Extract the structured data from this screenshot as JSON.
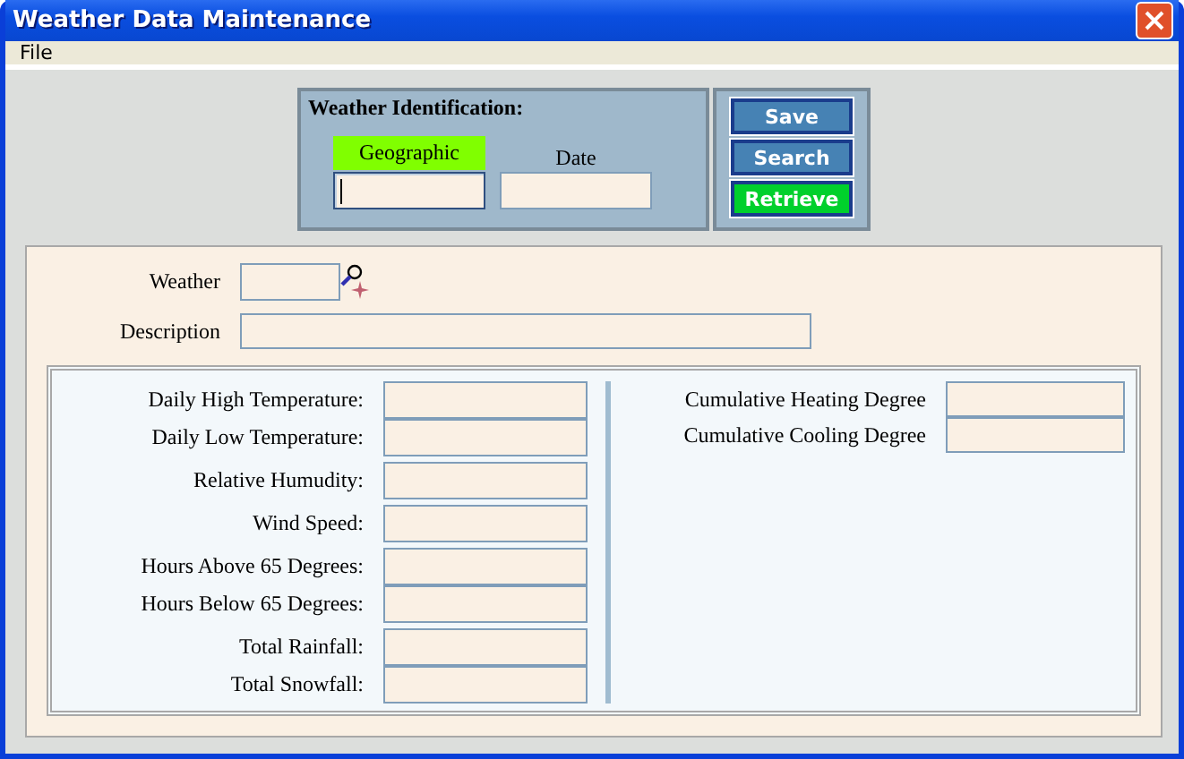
{
  "window": {
    "title": "Weather Data Maintenance"
  },
  "menu": [
    "File"
  ],
  "identification": {
    "title": "Weather Identification:",
    "fields": [
      {
        "label": "Geographic",
        "highlighted": true,
        "focused": true
      },
      {
        "label": "Date",
        "highlighted": false,
        "focused": false
      }
    ]
  },
  "buttons": [
    {
      "label": "Save",
      "color": "#4682b4"
    },
    {
      "label": "Search",
      "color": "#4682b4"
    },
    {
      "label": "Retrieve",
      "color": "#00d02c"
    }
  ],
  "weather": {
    "label": "Weather"
  },
  "description": {
    "label": "Description"
  },
  "left_groups": [
    [
      {
        "label": "Daily High Temperature:"
      },
      {
        "label": "Daily Low Temperature:"
      }
    ],
    [
      {
        "label": "Relative Humudity:"
      }
    ],
    [
      {
        "label": "Wind Speed:"
      }
    ],
    [
      {
        "label": "Hours Above 65 Degrees:"
      },
      {
        "label": "Hours Below 65 Degrees:"
      }
    ],
    [
      {
        "label": "Total Rainfall:"
      },
      {
        "label": "Total Snowfall:"
      }
    ]
  ],
  "right_fields": [
    {
      "label": "Cumulative Heating Degree"
    },
    {
      "label": "Cumulative Cooling Degree"
    }
  ]
}
